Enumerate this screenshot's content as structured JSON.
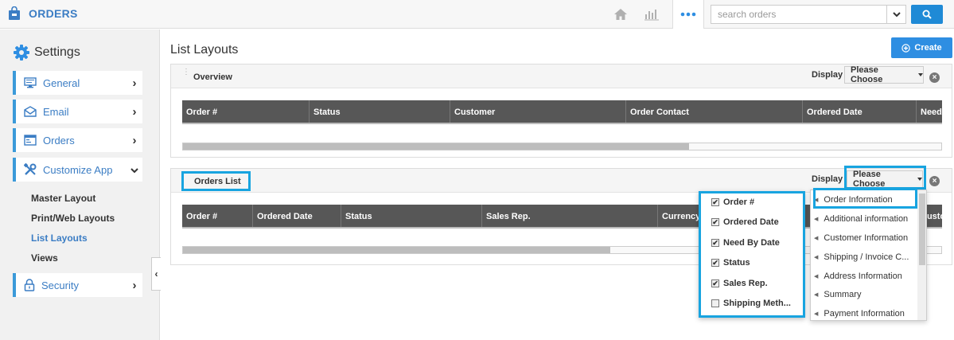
{
  "app": {
    "title": "ORDERS"
  },
  "search": {
    "placeholder": "search orders"
  },
  "sidebar": {
    "title": "Settings",
    "items": [
      {
        "label": "General"
      },
      {
        "label": "Email"
      },
      {
        "label": "Orders"
      },
      {
        "label": "Customize App"
      },
      {
        "label": "Security"
      }
    ],
    "subitems": [
      {
        "label": "Master Layout"
      },
      {
        "label": "Print/Web Layouts"
      },
      {
        "label": "List Layouts"
      },
      {
        "label": "Views"
      }
    ]
  },
  "main": {
    "title": "List Layouts",
    "create_label": "Create",
    "display_label": "Display",
    "choose_label": "Please Choose",
    "overview": {
      "title": "Overview",
      "columns": [
        "Order #",
        "Status",
        "Customer",
        "Order Contact",
        "Ordered Date",
        "Need"
      ]
    },
    "orders_list": {
      "title": "Orders List",
      "columns": [
        "Order #",
        "Ordered Date",
        "Status",
        "Sales Rep.",
        "Currency",
        "Customer"
      ]
    }
  },
  "field_checklist": [
    {
      "label": "Order #",
      "checked": true
    },
    {
      "label": "Ordered Date",
      "checked": true
    },
    {
      "label": "Need By Date",
      "checked": true
    },
    {
      "label": "Status",
      "checked": true
    },
    {
      "label": "Sales Rep.",
      "checked": true
    },
    {
      "label": "Shipping Meth...",
      "checked": false
    }
  ],
  "category_menu": [
    {
      "label": "Order Information"
    },
    {
      "label": "Additional information"
    },
    {
      "label": "Customer Information"
    },
    {
      "label": "Shipping / Invoice C..."
    },
    {
      "label": "Address Information"
    },
    {
      "label": "Summary"
    },
    {
      "label": "Payment Information"
    }
  ],
  "colors": {
    "accent": "#3b7dc4",
    "highlight": "#18a4e0",
    "button": "#2e8ee2",
    "grid_header": "#575757"
  },
  "icons": [
    "bag-icon",
    "home-icon",
    "chart-icon",
    "more-icon",
    "search-icon",
    "gear-icon",
    "monitor-icon",
    "envelope-icon",
    "orders-icon",
    "tools-icon",
    "lock-icon"
  ]
}
